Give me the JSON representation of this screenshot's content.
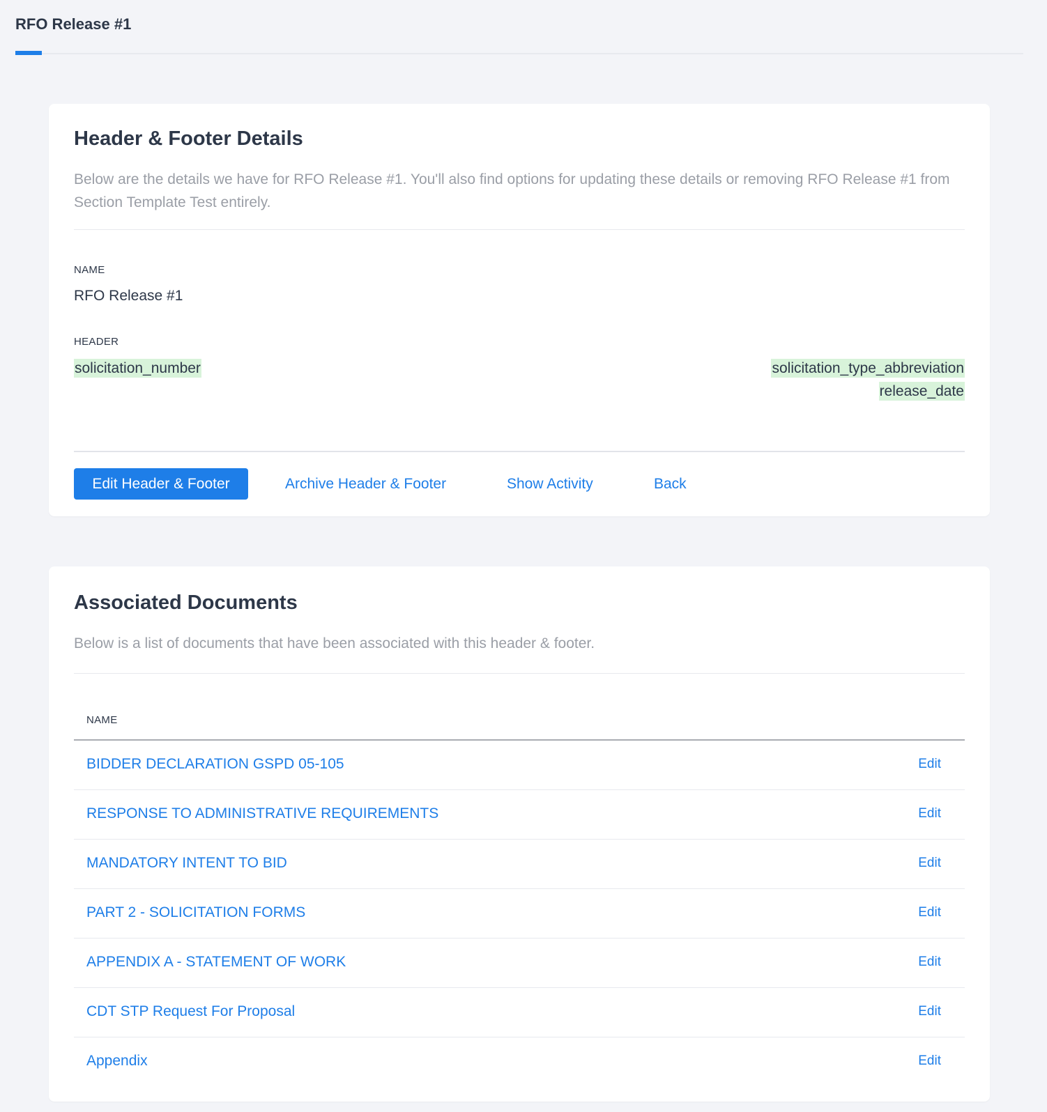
{
  "tabs": [
    {
      "label": "RFO Release #1",
      "active": true
    }
  ],
  "details": {
    "title": "Header & Footer Details",
    "description": "Below are the details we have for RFO Release #1. You'll also find options for updating these details or removing RFO Release #1 from Section Template Test entirely.",
    "name_label": "NAME",
    "name_value": "RFO Release #1",
    "header_label": "HEADER",
    "header_left_tags": [
      "solicitation_number"
    ],
    "header_right_tags": [
      "solicitation_type_abbreviation",
      "release_date"
    ],
    "tag_color": "#d8f3da",
    "actions": {
      "edit": "Edit Header & Footer",
      "archive": "Archive Header & Footer",
      "activity": "Show Activity",
      "back": "Back"
    }
  },
  "documents": {
    "title": "Associated Documents",
    "description": "Below is a list of documents that have been associated with this header & footer.",
    "column_name": "NAME",
    "rows": [
      {
        "name": "BIDDER DECLARATION GSPD 05-105",
        "action": "Edit"
      },
      {
        "name": "RESPONSE TO ADMINISTRATIVE REQUIREMENTS",
        "action": "Edit"
      },
      {
        "name": "MANDATORY INTENT TO BID",
        "action": "Edit"
      },
      {
        "name": "PART 2 - SOLICITATION FORMS",
        "action": "Edit"
      },
      {
        "name": "APPENDIX A - STATEMENT OF WORK",
        "action": "Edit"
      },
      {
        "name": "CDT STP Request For Proposal",
        "action": "Edit"
      },
      {
        "name": "Appendix",
        "action": "Edit"
      }
    ]
  },
  "colors": {
    "accent": "#1e7ee8",
    "background": "#f3f4f8",
    "text": "#2d3748",
    "muted": "#9a9ea6"
  }
}
